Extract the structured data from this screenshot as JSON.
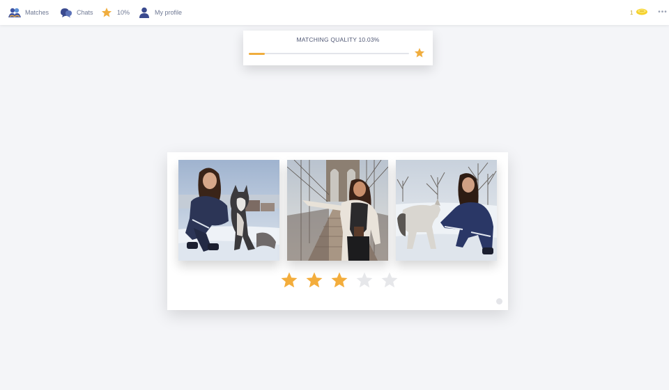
{
  "nav": {
    "items": [
      {
        "key": "matches",
        "label": "Matches",
        "icon": "matches-icon"
      },
      {
        "key": "chats",
        "label": "Chats",
        "icon": "chat-bubbles-icon"
      },
      {
        "key": "rating",
        "label": "10%",
        "icon": "star-icon"
      },
      {
        "key": "profile",
        "label": "My profile",
        "icon": "user-icon"
      }
    ],
    "coins": {
      "count": "1",
      "icon": "coin-icon"
    },
    "more": {
      "icon": "more-icon"
    }
  },
  "matching_quality": {
    "title": "MATCHING QUALITY 10.03%",
    "progress_percent": 10.03,
    "icon": "star-icon"
  },
  "photos": [
    {
      "name": "photo-1",
      "description": "woman crouching with husky dog in snow"
    },
    {
      "name": "photo-2",
      "description": "woman on bridge walkway"
    },
    {
      "name": "photo-3",
      "description": "woman kneeling with dog in snowy park"
    }
  ],
  "rating": {
    "value": 3,
    "max": 5
  },
  "colors": {
    "accent": "#f0ad3e",
    "star_filled": "#f3ad3c",
    "star_empty": "#e6e7ea",
    "nav_icon": "#3a4a8f",
    "background": "#f4f5f8"
  }
}
